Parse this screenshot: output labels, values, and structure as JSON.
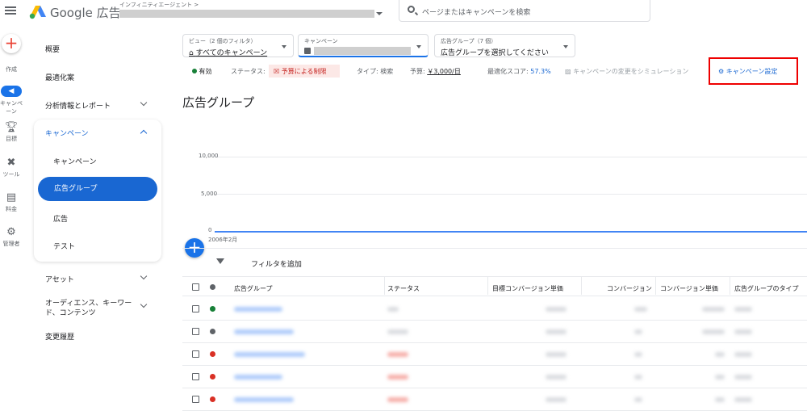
{
  "header": {
    "brand": "Google 広告",
    "account_label": "インフィニティエージェント >",
    "search_placeholder": "ページまたはキャンペーンを検索"
  },
  "rail": [
    {
      "label": "作成",
      "icon": "plus-icon"
    },
    {
      "label": "キャンペーン",
      "icon": "campaign-icon"
    },
    {
      "label": "目標",
      "icon": "trophy-icon"
    },
    {
      "label": "ツール",
      "icon": "tools-icon"
    },
    {
      "label": "料金",
      "icon": "billing-icon"
    },
    {
      "label": "管理者",
      "icon": "admin-gear-icon"
    }
  ],
  "nav": {
    "overview": "概要",
    "optimize": "最適化案",
    "insights": "分析情報とレポート",
    "campaigns_group": "キャンペーン",
    "campaigns": "キャンペーン",
    "ad_groups": "広告グループ",
    "ads": "広告",
    "test": "テスト",
    "assets": "アセット",
    "audience": "オーディエンス、キーワード、コンテンツ",
    "history": "変更履歴"
  },
  "selectors": {
    "view_label": "ビュー（2 個のフィルタ）",
    "view_value": "すべてのキャンペーン",
    "campaign_label": "キャンペーン",
    "adgroup_label": "広告グループ（7 個）",
    "adgroup_value": "広告グループを選択してください"
  },
  "status": {
    "enabled": "有効",
    "status_label": "ステータス:",
    "status_value": "予算による制限",
    "type": "タイプ: 検索",
    "budget_label": "予算:",
    "budget_value": "￥3,000/日",
    "opt_label": "最適化スコア:",
    "opt_value": "57.3%",
    "simulate": "キャンペーンの変更をシミュレーション",
    "settings": "キャンペーン設定"
  },
  "page_title": "広告グループ",
  "chart": {
    "y_ticks": [
      "10,000",
      "5,000",
      "0"
    ],
    "x_tick": "2006年2月"
  },
  "filter_label": "フィルタを追加",
  "table": {
    "headers": [
      "広告グループ",
      "ステータス",
      "目標コンバージョン単価",
      "コンバージョン",
      "コンバージョン単価",
      "広告グループのタイプ"
    ],
    "row_status_colors": [
      "#188038",
      "#5f6368",
      "#d93025",
      "#d93025",
      "#d93025"
    ]
  },
  "colors": {
    "accent": "#1a73e8",
    "highlight_box": "#ee0000"
  }
}
